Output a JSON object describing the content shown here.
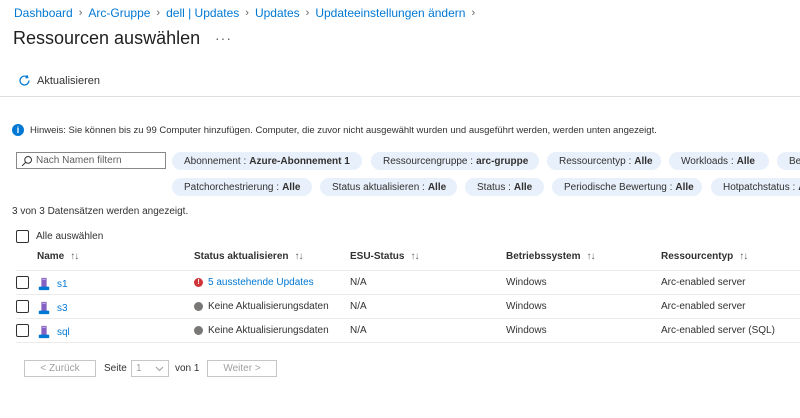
{
  "breadcrumb": [
    "Dashboard",
    "Arc-Gruppe",
    "dell | Updates",
    "Updates",
    "Updateeinstellungen ändern"
  ],
  "page_title": "Ressourcen auswählen",
  "more_label": "···",
  "toolbar": {
    "refresh_label": "Aktualisieren"
  },
  "info_text": "Hinweis: Sie können bis zu 99 Computer hinzufügen. Computer, die zuvor nicht ausgewählt wurden und ausgeführt werden, werden unten angezeigt.",
  "search": {
    "placeholder": "Nach Namen filtern"
  },
  "filters": {
    "row1": [
      {
        "label": "Abonnement :",
        "value": "Azure-Abonnement 1"
      },
      {
        "label": "Ressourcengruppe :",
        "value": "arc-gruppe"
      },
      {
        "label": "Ressourcentyp :",
        "value": "Alle"
      },
      {
        "label": "Workloads :",
        "value": "Alle"
      },
      {
        "label": "Be",
        "value": ""
      }
    ],
    "row2": [
      {
        "label": "Patchorchestrierung :",
        "value": "Alle"
      },
      {
        "label": "Status aktualisieren :",
        "value": "Alle"
      },
      {
        "label": "Status :",
        "value": "Alle"
      },
      {
        "label": "Periodische Bewertung :",
        "value": "Alle"
      },
      {
        "label": "Hotpatchstatus :",
        "value": "A"
      }
    ]
  },
  "record_count": "3 von 3 Datensätzen werden angezeigt.",
  "select_all_label": "Alle auswählen",
  "table": {
    "headers": [
      "Name",
      "Status aktualisieren",
      "ESU-Status",
      "Betriebssystem",
      "Ressourcentyp"
    ],
    "sort_glyph": "↑↓",
    "rows": [
      {
        "name": "s1",
        "status": "5 ausstehende Updates",
        "esu": "N/A",
        "os": "Windows",
        "type": "Arc-enabled server"
      },
      {
        "name": "s3",
        "status": "Keine Aktualisierungsdaten",
        "esu": "N/A",
        "os": "Windows",
        "type": "Arc-enabled server"
      },
      {
        "name": "sql",
        "status": "Keine Aktualisierungsdaten",
        "esu": "N/A",
        "os": "Windows",
        "type": "Arc-enabled server (SQL)"
      }
    ]
  },
  "pager": {
    "prev_label": "< Zurück",
    "page_label": "Seite",
    "page_value": "1",
    "of_label": "von 1",
    "next_label": "Weiter >"
  },
  "colors": {
    "accent": "#0078d4",
    "pill_bg": "#e8f0fb",
    "error": "#d13438",
    "neutral_dot": "#797775"
  }
}
